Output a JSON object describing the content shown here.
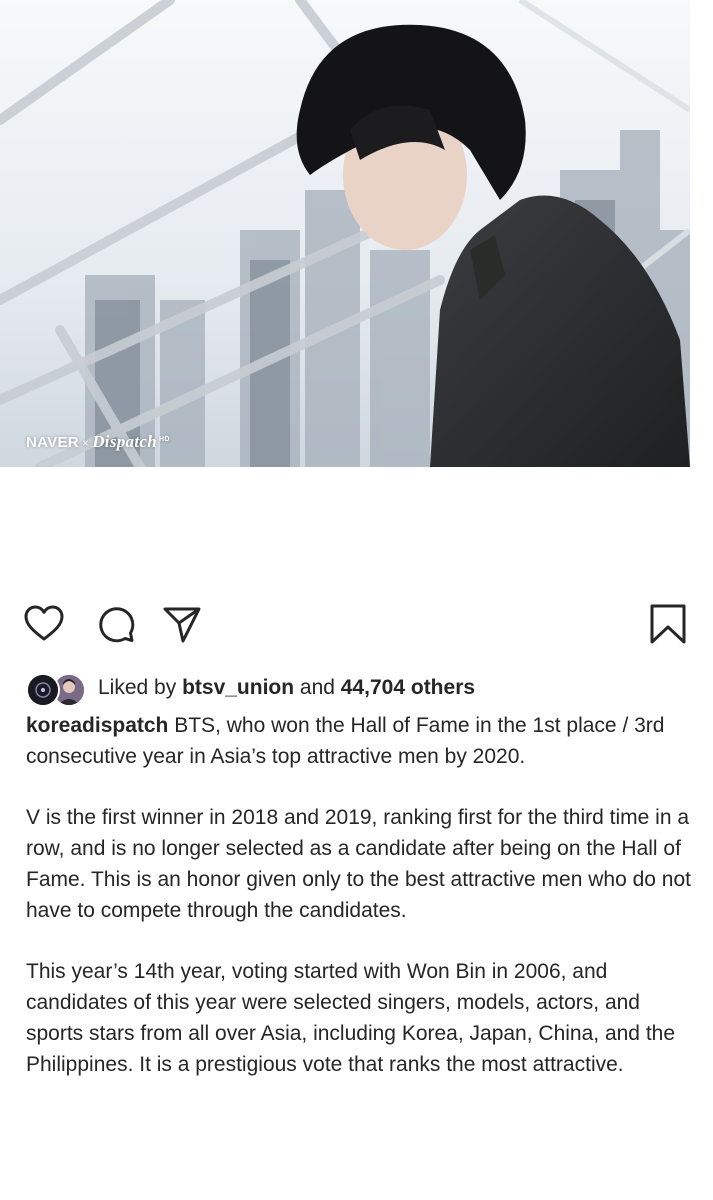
{
  "post": {
    "image": {
      "watermark_brand": "NAVER",
      "watermark_sep": "×",
      "watermark_partner": "Dispatch",
      "watermark_hd": "HD"
    },
    "actions": {
      "like_icon": "heart-outline-icon",
      "comment_icon": "comment-bubble-icon",
      "share_icon": "paper-plane-icon",
      "save_icon": "bookmark-outline-icon"
    },
    "likes": {
      "prefix": "Liked by ",
      "user": "btsv_union",
      "middle": " and ",
      "count": "44,704 others"
    },
    "caption": {
      "username": "koreadispatch",
      "first": " BTS, who won the Hall of Fame in the 1st place / 3rd consecutive year in Asia’s top attractive men by 2020.",
      "paragraph2": "V is the first winner in 2018 and 2019, ranking first for the third time in a row, and is no longer selected as a candidate after being on the Hall of Fame. This is an honor given only to the best attractive men who do not have to compete through the candidates.",
      "paragraph3": "This year’s 14th year, voting started with Won Bin in 2006, and candidates of this year were selected singers, models, actors, and sports stars from all over Asia, including Korea, Japan, China, and the Philippines. It is a prestigious vote that ranks the most attractive."
    }
  },
  "colors": {
    "text": "#262626",
    "background": "#ffffff"
  }
}
